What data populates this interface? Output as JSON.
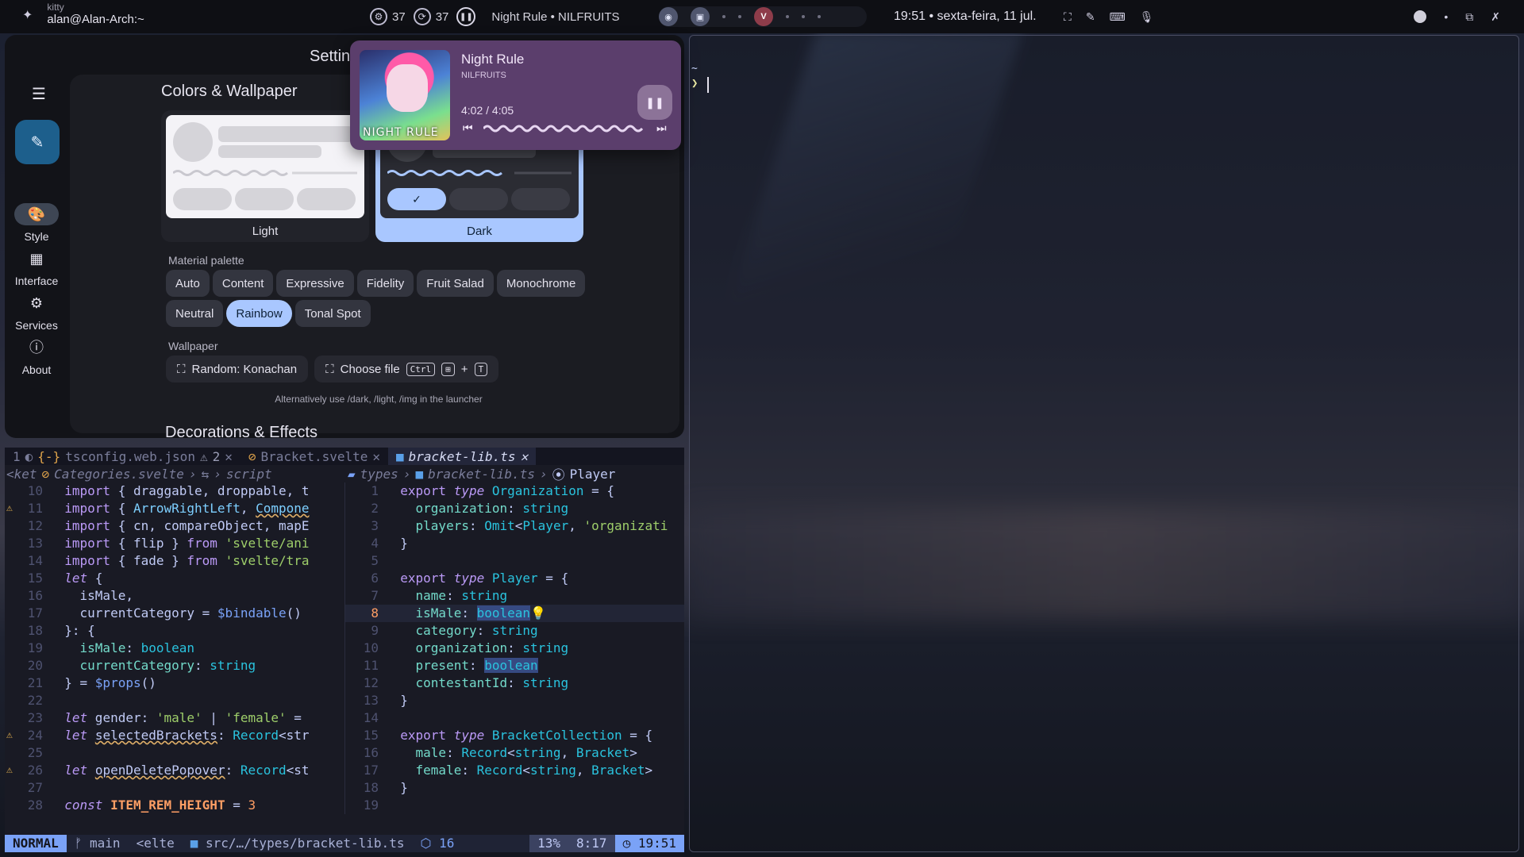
{
  "topbar": {
    "active_window_class": "kitty",
    "active_window_title": "alan@Alan-Arch:~",
    "cpu_value": "37",
    "mem_value": "37",
    "media_text": "Night Rule • NILFRUITS",
    "clock_text": "19:51 • sexta-feira, 11 jul."
  },
  "settings": {
    "window_title": "Settings",
    "nav": {
      "style": "Style",
      "interface": "Interface",
      "services": "Services",
      "about": "About"
    },
    "section_title": "Colors & Wallpaper",
    "theme_light": "Light",
    "theme_dark": "Dark",
    "palette_label": "Material palette",
    "palettes_row1": [
      "Auto",
      "Content",
      "Expressive",
      "Fidelity",
      "Fruit Salad",
      "Monochrome"
    ],
    "palettes_row2": [
      "Neutral",
      "Rainbow",
      "Tonal Spot"
    ],
    "selected_palette": "Rainbow",
    "wallpaper_label": "Wallpaper",
    "random_button": "Random: Konachan",
    "choose_button": "Choose file",
    "shortcut_ctrl": "Ctrl",
    "shortcut_plus": "+",
    "shortcut_t": "T",
    "hint": "Alternatively use /dark, /light, /img in the launcher",
    "next_section": "Decorations & Effects"
  },
  "media": {
    "title": "Night Rule",
    "artist": "NILFRUITS",
    "time": "4:02 / 4:05",
    "cover_text": "NIGHT RULE",
    "progress": 0.988
  },
  "terminal": {
    "cwd": "~",
    "prompt": "❯"
  },
  "nvim": {
    "tabs": [
      {
        "num": "1",
        "icon": "{-}",
        "name": "tsconfig.web.json",
        "warnings": "2"
      },
      {
        "icon": "⊘",
        "name": "Bracket.svelte"
      },
      {
        "icon": "■",
        "name": "bracket-lib.ts"
      }
    ],
    "left_winbar": [
      "<ket",
      "Categories.svelte",
      "›",
      "⇆",
      "›",
      "script"
    ],
    "right_winbar": [
      "types",
      "›",
      "bracket-lib.ts",
      "›",
      "Player"
    ],
    "statusline": {
      "mode": "NORMAL",
      "branch": "main",
      "module": "<elte",
      "path": "src/…/types/bracket-lib.ts",
      "diagnostics": "16",
      "percent": "13%",
      "position": "8:17",
      "time": "19:51"
    }
  }
}
